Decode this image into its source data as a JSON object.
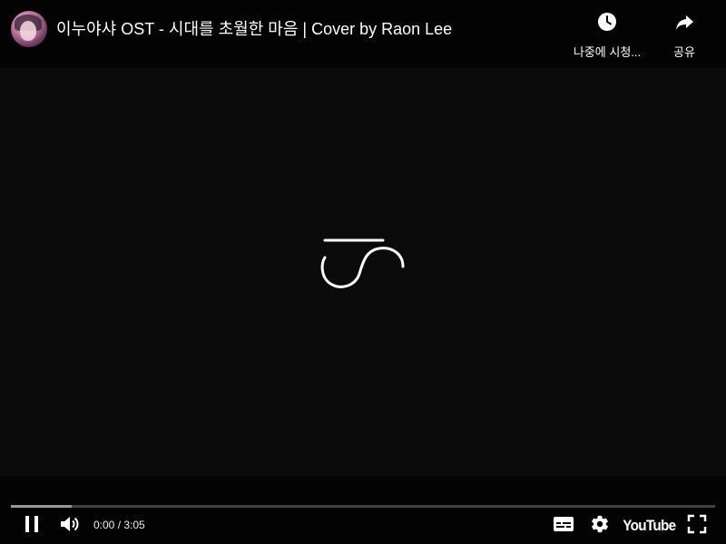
{
  "header": {
    "title": "이누야샤 OST - 시대를 초월한 마음 | Cover by Raon Lee",
    "watch_later_label": "나중에 시청...",
    "share_label": "공유"
  },
  "controls": {
    "current_time": "0:00",
    "duration": "3:05",
    "time_text": "0:00 / 3:05",
    "youtube_label": "YouTube",
    "progress_played": 0.0,
    "progress_buffered": 0.086
  },
  "state": {
    "playing": true,
    "loading": true
  },
  "colors": {
    "background": "#0b0b0b",
    "bar_background": "#030303",
    "progress_played": "#ff0000",
    "text": "#ffffff"
  },
  "icons": {
    "watch_later": "clock-icon",
    "share": "share-arrow-icon",
    "pause": "pause-icon",
    "volume": "volume-icon",
    "subtitles": "subtitles-icon",
    "settings": "gear-icon",
    "fullscreen": "fullscreen-icon"
  }
}
